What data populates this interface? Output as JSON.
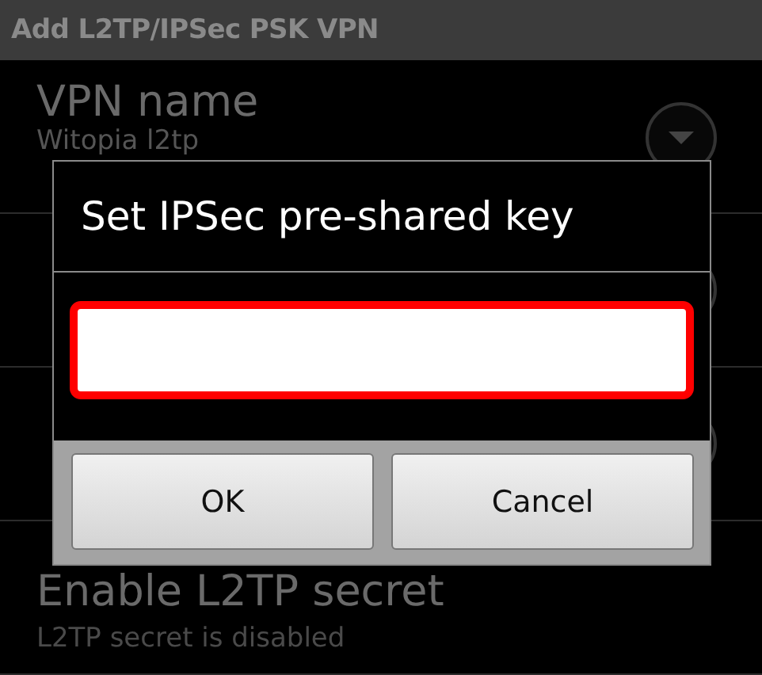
{
  "window": {
    "title": "Add L2TP/IPSec PSK VPN"
  },
  "items": [
    {
      "kind": "dropdown",
      "title": "VPN name",
      "subtitle": "Witopia l2tp"
    },
    {
      "kind": "dropdown"
    },
    {
      "kind": "dropdown"
    },
    {
      "kind": "plain",
      "title": "Enable L2TP secret",
      "subtitle": "L2TP secret is disabled"
    }
  ],
  "dialog": {
    "title": "Set IPSec pre-shared key",
    "buttons": [
      "OK",
      "Cancel"
    ]
  }
}
